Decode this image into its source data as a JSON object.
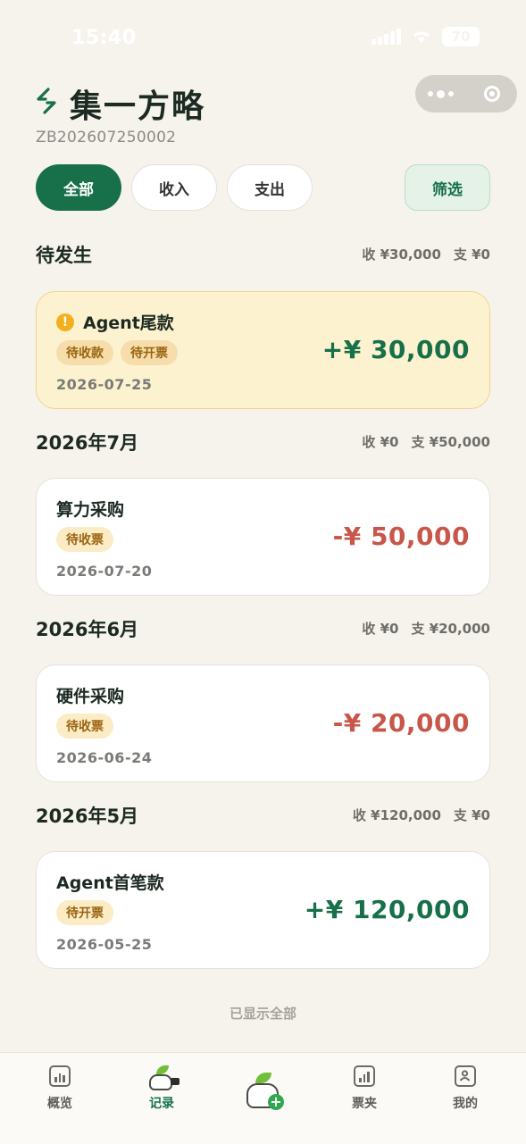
{
  "status_bar": {
    "time": "15:40",
    "battery": "70"
  },
  "header": {
    "title": "集一方略",
    "book_id": "ZB202607250002"
  },
  "filters": {
    "all": "全部",
    "income": "收入",
    "expense": "支出",
    "filter": "筛选"
  },
  "groups": [
    {
      "title": "待发生",
      "sum_in": "收 ¥30,000",
      "sum_out": "支 ¥0",
      "card": {
        "title": "Agent尾款",
        "tags": [
          "待收款",
          "待开票"
        ],
        "date": "2026-07-25",
        "amount": "+¥ 30,000",
        "type": "income",
        "alert": true
      }
    },
    {
      "title": "2026年7月",
      "sum_in": "收 ¥0",
      "sum_out": "支 ¥50,000",
      "card": {
        "title": "算力采购",
        "tags": [
          "待收票"
        ],
        "date": "2026-07-20",
        "amount": "-¥ 50,000",
        "type": "expense"
      }
    },
    {
      "title": "2026年6月",
      "sum_in": "收 ¥0",
      "sum_out": "支 ¥20,000",
      "card": {
        "title": "硬件采购",
        "tags": [
          "待收票"
        ],
        "date": "2026-06-24",
        "amount": "-¥ 20,000",
        "type": "expense"
      }
    },
    {
      "title": "2026年5月",
      "sum_in": "收 ¥120,000",
      "sum_out": "支 ¥0",
      "card": {
        "title": "Agent首笔款",
        "tags": [
          "待开票"
        ],
        "date": "2026-05-25",
        "amount": "+¥ 120,000",
        "type": "income"
      }
    }
  ],
  "list_end": "已显示全部",
  "tabbar": {
    "overview": "概览",
    "records": "记录",
    "tickets": "票夹",
    "mine": "我的"
  },
  "colors": {
    "brand_green": "#17704a",
    "expense_red": "#c8564a",
    "warning_yellow": "#f2b01e"
  }
}
